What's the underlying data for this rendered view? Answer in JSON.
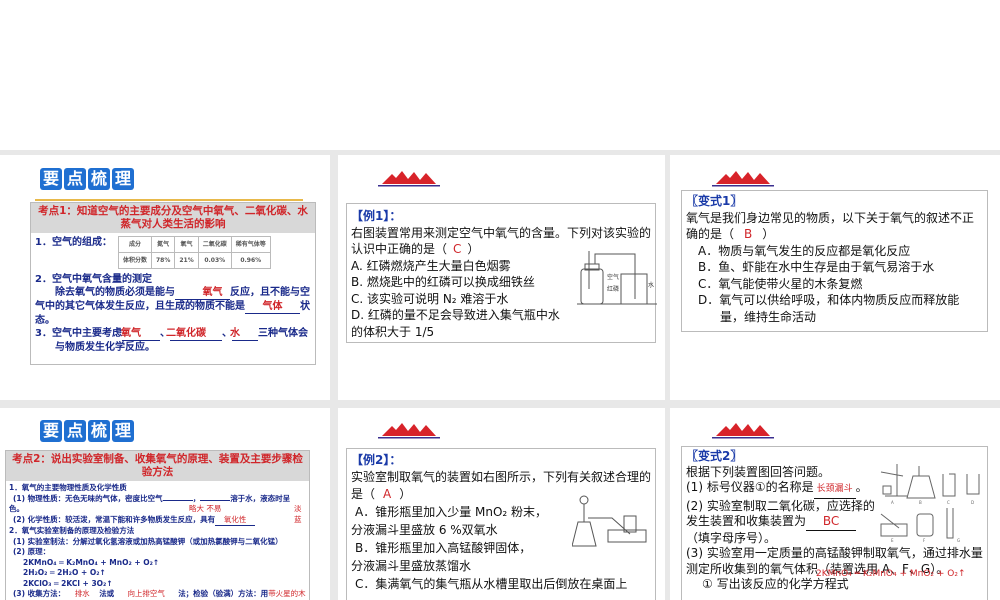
{
  "slides": [
    {
      "header_tiles": [
        "要",
        "点",
        "梳",
        "理"
      ],
      "topic": "考点1：知道空气的主要成分及空气中氧气、二氧化碳、水蒸气对人类生活的影响",
      "item1": "1．空气的组成：",
      "table": {
        "headers": [
          "成分",
          "氮气",
          "氧气",
          "二氧化碳",
          "稀有气体等"
        ],
        "row": [
          "体积分数",
          "78%",
          "21%",
          "0.03%",
          "0.96%"
        ]
      },
      "item2_title": "2．空气中氧气含量的测定",
      "item2_a": "除去氧气的物质必须是能与",
      "item2_blank1": "氧气",
      "item2_b": "反应，且不能与空气中的其它气体发生反应，且生成的物质不能是",
      "item2_blank2": "气体",
      "item2_c": "状态。",
      "item3_a": "3．空气中主要考虑",
      "item3_blank1": "氧气",
      "item3_sep": "、",
      "item3_blank2": "二氧化碳",
      "item3_blank3": "水",
      "item3_b": "三种气体会与物质发生化学反应。"
    },
    {
      "title": "【例1】：",
      "question": "右图装置常用来测定空气中氧气的含量。下列对该实验的认识中正确的是（",
      "answer": "C",
      "close": "）",
      "options": [
        "A. 红磷燃烧产生大量白色烟雾",
        "B. 燃烧匙中的红磷可以换成细铁丝",
        "C. 该实验可说明 N₂ 难溶于水",
        "D. 红磷的量不足会导致进入集气瓶中水的体积大于 1/5"
      ],
      "figure_labels": [
        "空气",
        "红磷",
        "水"
      ]
    },
    {
      "title": "〖变式1〗",
      "question": "氧气是我们身边常见的物质，以下关于氧气的叙述不正确的是（",
      "answer": "B",
      "close": "）",
      "options": [
        "A．物质与氧气发生的反应都是氧化反应",
        "B．鱼、虾能在水中生存是由于氧气易溶于水",
        "C．氧气能使带火星的木条复燃",
        "D．氧气可以供给呼吸，和体内物质反应而释放能量，维持生命活动"
      ]
    },
    {
      "header_tiles": [
        "要",
        "点",
        "梳",
        "理"
      ],
      "topic": "考点2：说出实验室制备、收集氧气的原理、装置及主要步骤检验方法",
      "l1": "1．氧气的主要物理性质及化学性质",
      "l2": "(1) 物理性质：无色无味的气体，密度比空气",
      "l2b": "，",
      "l2c": "溶于水，液态时呈",
      "l3": "色。",
      "ans_a": "略大 不易",
      "ans_b": "淡蓝",
      "l4": "(2) 化学性质：较活泼，常温下能和许多物质发生反应，具有",
      "ans_c": "氧化性",
      "l5": "2．氧气实验室制备的原理及检验方法",
      "l6": "(1) 实验室制法：分解过氧化氢溶液或加热高锰酸钾（或加热氯酸钾与二氧化锰）",
      "l7": "(2) 原理：",
      "eq": [
        "2KMnO₄ ═ K₂MnO₄ + MnO₂ + O₂↑",
        "2H₂O₂ ═ 2H₂O + O₂↑",
        "2KClO₃ ═ 2KCl + 3O₂↑"
      ],
      "l8a": "(3) 收集方法：",
      "ans_d": "排水",
      "l8b": "法或",
      "ans_e": "向上排空气",
      "l8c": "法；检验（验满）方法：用",
      "ans_f": "带火星的木条"
    },
    {
      "title": "【例2】：",
      "question": "实验室制取氧气的装置如右图所示，下列有关叙述合理的是（",
      "answer": "A",
      "close": "）",
      "options": [
        "A．锥形瓶里加入少量 MnO₂ 粉末，",
        "分液漏斗里盛放 6 %双氧水",
        "B．锥形瓶里加入高锰酸钾固体，",
        "分液漏斗里盛放蒸馏水",
        "C．集满氧气的集气瓶从水槽里取出后倒放在桌面上"
      ]
    },
    {
      "title": "〖变式2〗",
      "intro": "根据下列装置图回答问题。",
      "q1": "(1) 标号仪器①的名称是",
      "a1": "长颈漏斗",
      "q1end": "。",
      "q2": "(2) 实验室制取二氧化碳，应选择的发生装置和收集装置为",
      "a2": "BC",
      "q2end": "（填字母序号）。",
      "q3": "(3) 实验室用一定质量的高锰酸钾制取氧气，通过排水量测定所收集到的氧气体积（装置选用 A、F、G）。",
      "q3a": "① 写出该反应的化学方程式",
      "a3": "2KMnO₄ ═ K₂MnO₄ + MnO₂ + O₂↑",
      "figure_labels": [
        "A",
        "B",
        "C",
        "D",
        "E",
        "F",
        "G"
      ]
    }
  ]
}
